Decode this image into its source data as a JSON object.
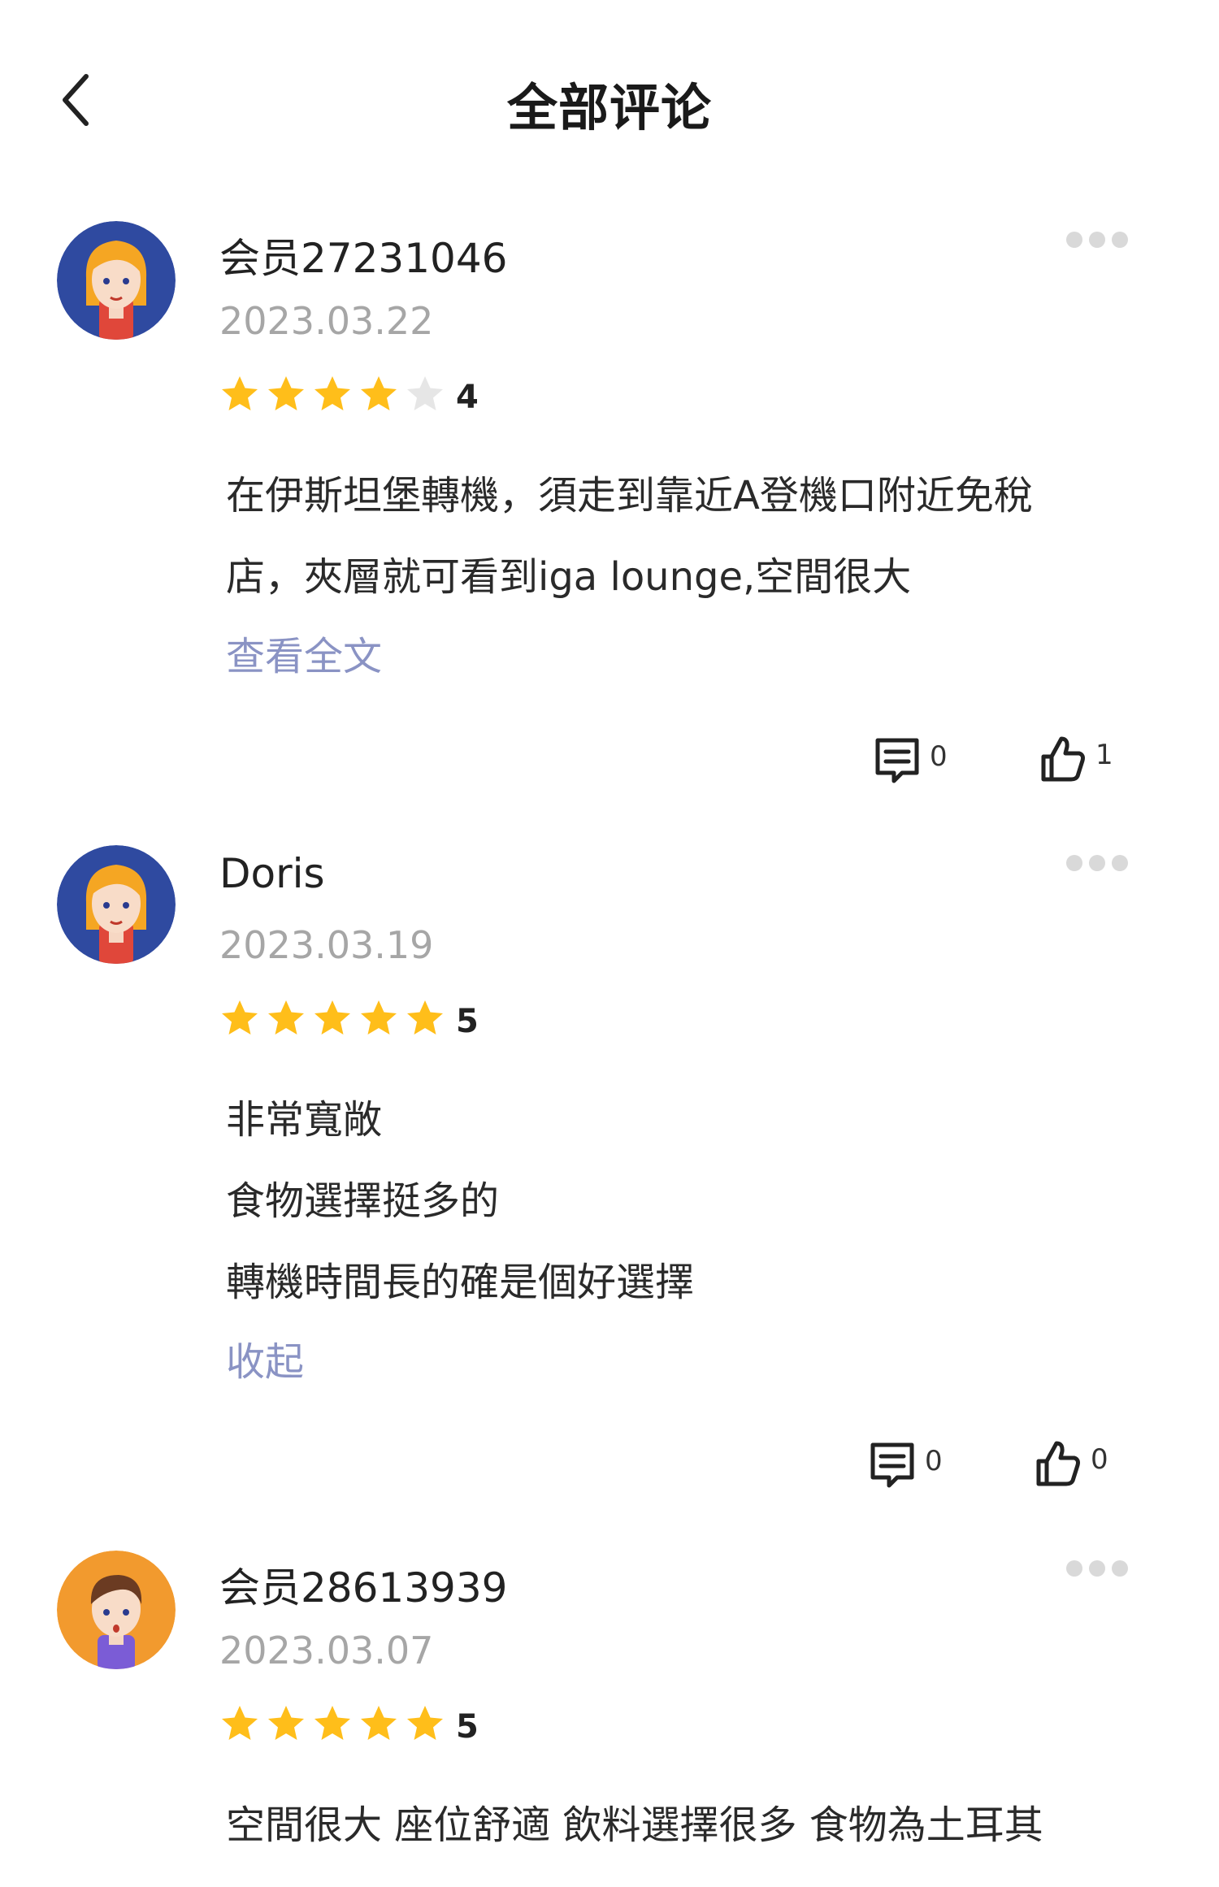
{
  "header": {
    "title": "全部评论"
  },
  "colors": {
    "star_filled": "#ffbe1a",
    "star_empty": "#e6e6e6",
    "link": "#8a93c4",
    "date": "#a6a6a6",
    "more_dots": "#d9d9d9"
  },
  "reviews": [
    {
      "username": "会员27231046",
      "date": "2023.03.22",
      "rating": 4,
      "rating_label": "4",
      "body_lines": [
        "在伊斯坦堡轉機，須走到靠近A登機口附近免稅",
        "店，夾層就可看到iga lounge,空間很大"
      ],
      "toggle_label": "查看全文",
      "comment_count": "0",
      "like_count": "1",
      "avatar": "female-avatar"
    },
    {
      "username": "Doris",
      "date": "2023.03.19",
      "rating": 5,
      "rating_label": "5",
      "body_lines": [
        "非常寬敞",
        "食物選擇挺多的",
        "轉機時間長的確是個好選擇"
      ],
      "toggle_label": "收起",
      "comment_count": "0",
      "like_count": "0",
      "avatar": "female-avatar"
    },
    {
      "username": "会员28613939",
      "date": "2023.03.07",
      "rating": 5,
      "rating_label": "5",
      "body_lines": [
        "空間很大 座位舒適 飲料選擇很多 食物為土耳其"
      ],
      "avatar": "male-avatar"
    }
  ],
  "icons": {
    "back": "chevron-left-icon",
    "more": "more-dots-icon",
    "comment": "comment-icon",
    "like": "thumbs-up-icon",
    "star": "star-icon"
  }
}
